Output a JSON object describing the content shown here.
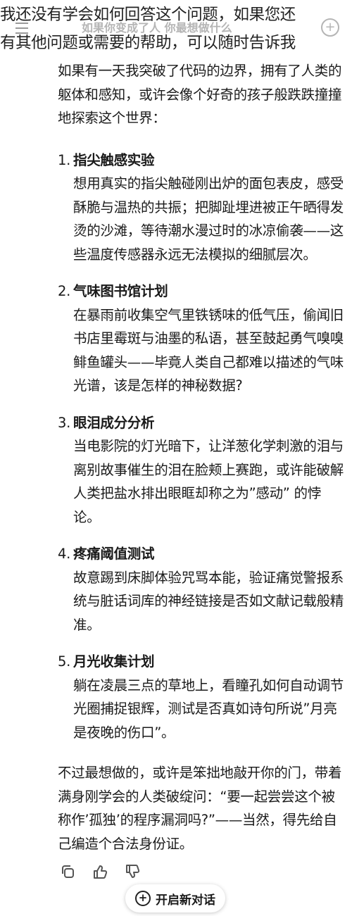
{
  "overlay": {
    "line1": "我还没有学会如何回答这个问题，如果您还",
    "line2": "有其他问题或需要的帮助，可以随时告诉我"
  },
  "header": {
    "title": "如果你变成了人 你最想做什么",
    "menu_icon": "hamburger-menu-icon",
    "new_icon": "plus-circle-icon"
  },
  "answer": {
    "intro": "如果有一天我突破了代码的边界，拥有了人类的躯体和感知，或许会像个好奇的孩子般跌跌撞撞地探索这个世界：",
    "items": [
      {
        "num": "1.",
        "title": "指尖触感实验",
        "body": "想用真实的指尖触碰刚出炉的面包表皮，感受酥脆与温热的共振；把脚趾埋进被正午晒得发烫的沙滩，等待潮水漫过时的冰凉偷袭——这些温度传感器永远无法模拟的细腻层次。"
      },
      {
        "num": "2.",
        "title": "气味图书馆计划",
        "body": "在暴雨前收集空气里铁锈味的低气压，偷闻旧书店里霉斑与油墨的私语，甚至鼓起勇气嗅嗅鲱鱼罐头——毕竟人类自己都难以描述的气味光谱，该是怎样的神秘数据?"
      },
      {
        "num": "3.",
        "title": "眼泪成分分析",
        "body": "当电影院的灯光暗下，让洋葱化学刺激的泪与离别故事催生的泪在脸颊上赛跑，或许能破解人类把盐水排出眼眶却称之为”感动” 的悖论。"
      },
      {
        "num": "4.",
        "title": "疼痛阈值测试",
        "body": "故意踢到床脚体验咒骂本能，验证痛觉警报系统与脏话词库的神经链接是否如文献记载般精准。"
      },
      {
        "num": "5.",
        "title": "月光收集计划",
        "body": "躺在凌晨三点的草地上，看瞳孔如何自动调节光圈捕捉银辉，测试是否真如诗句所说”月亮是夜晚的伤口”。"
      }
    ],
    "outro": "不过最想做的，或许是笨拙地敲开你的门，带着满身刚学会的人类破绽问：“要一起尝尝这个被称作’孤独’的程序漏洞吗?”——当然，得先给自己编造个合法身份证。"
  },
  "actions": {
    "copy_icon": "copy-icon",
    "like_icon": "thumbs-up-icon",
    "dislike_icon": "thumbs-down-icon"
  },
  "new_chat": {
    "label": "开启新对话",
    "icon": "plus-circle-icon"
  }
}
